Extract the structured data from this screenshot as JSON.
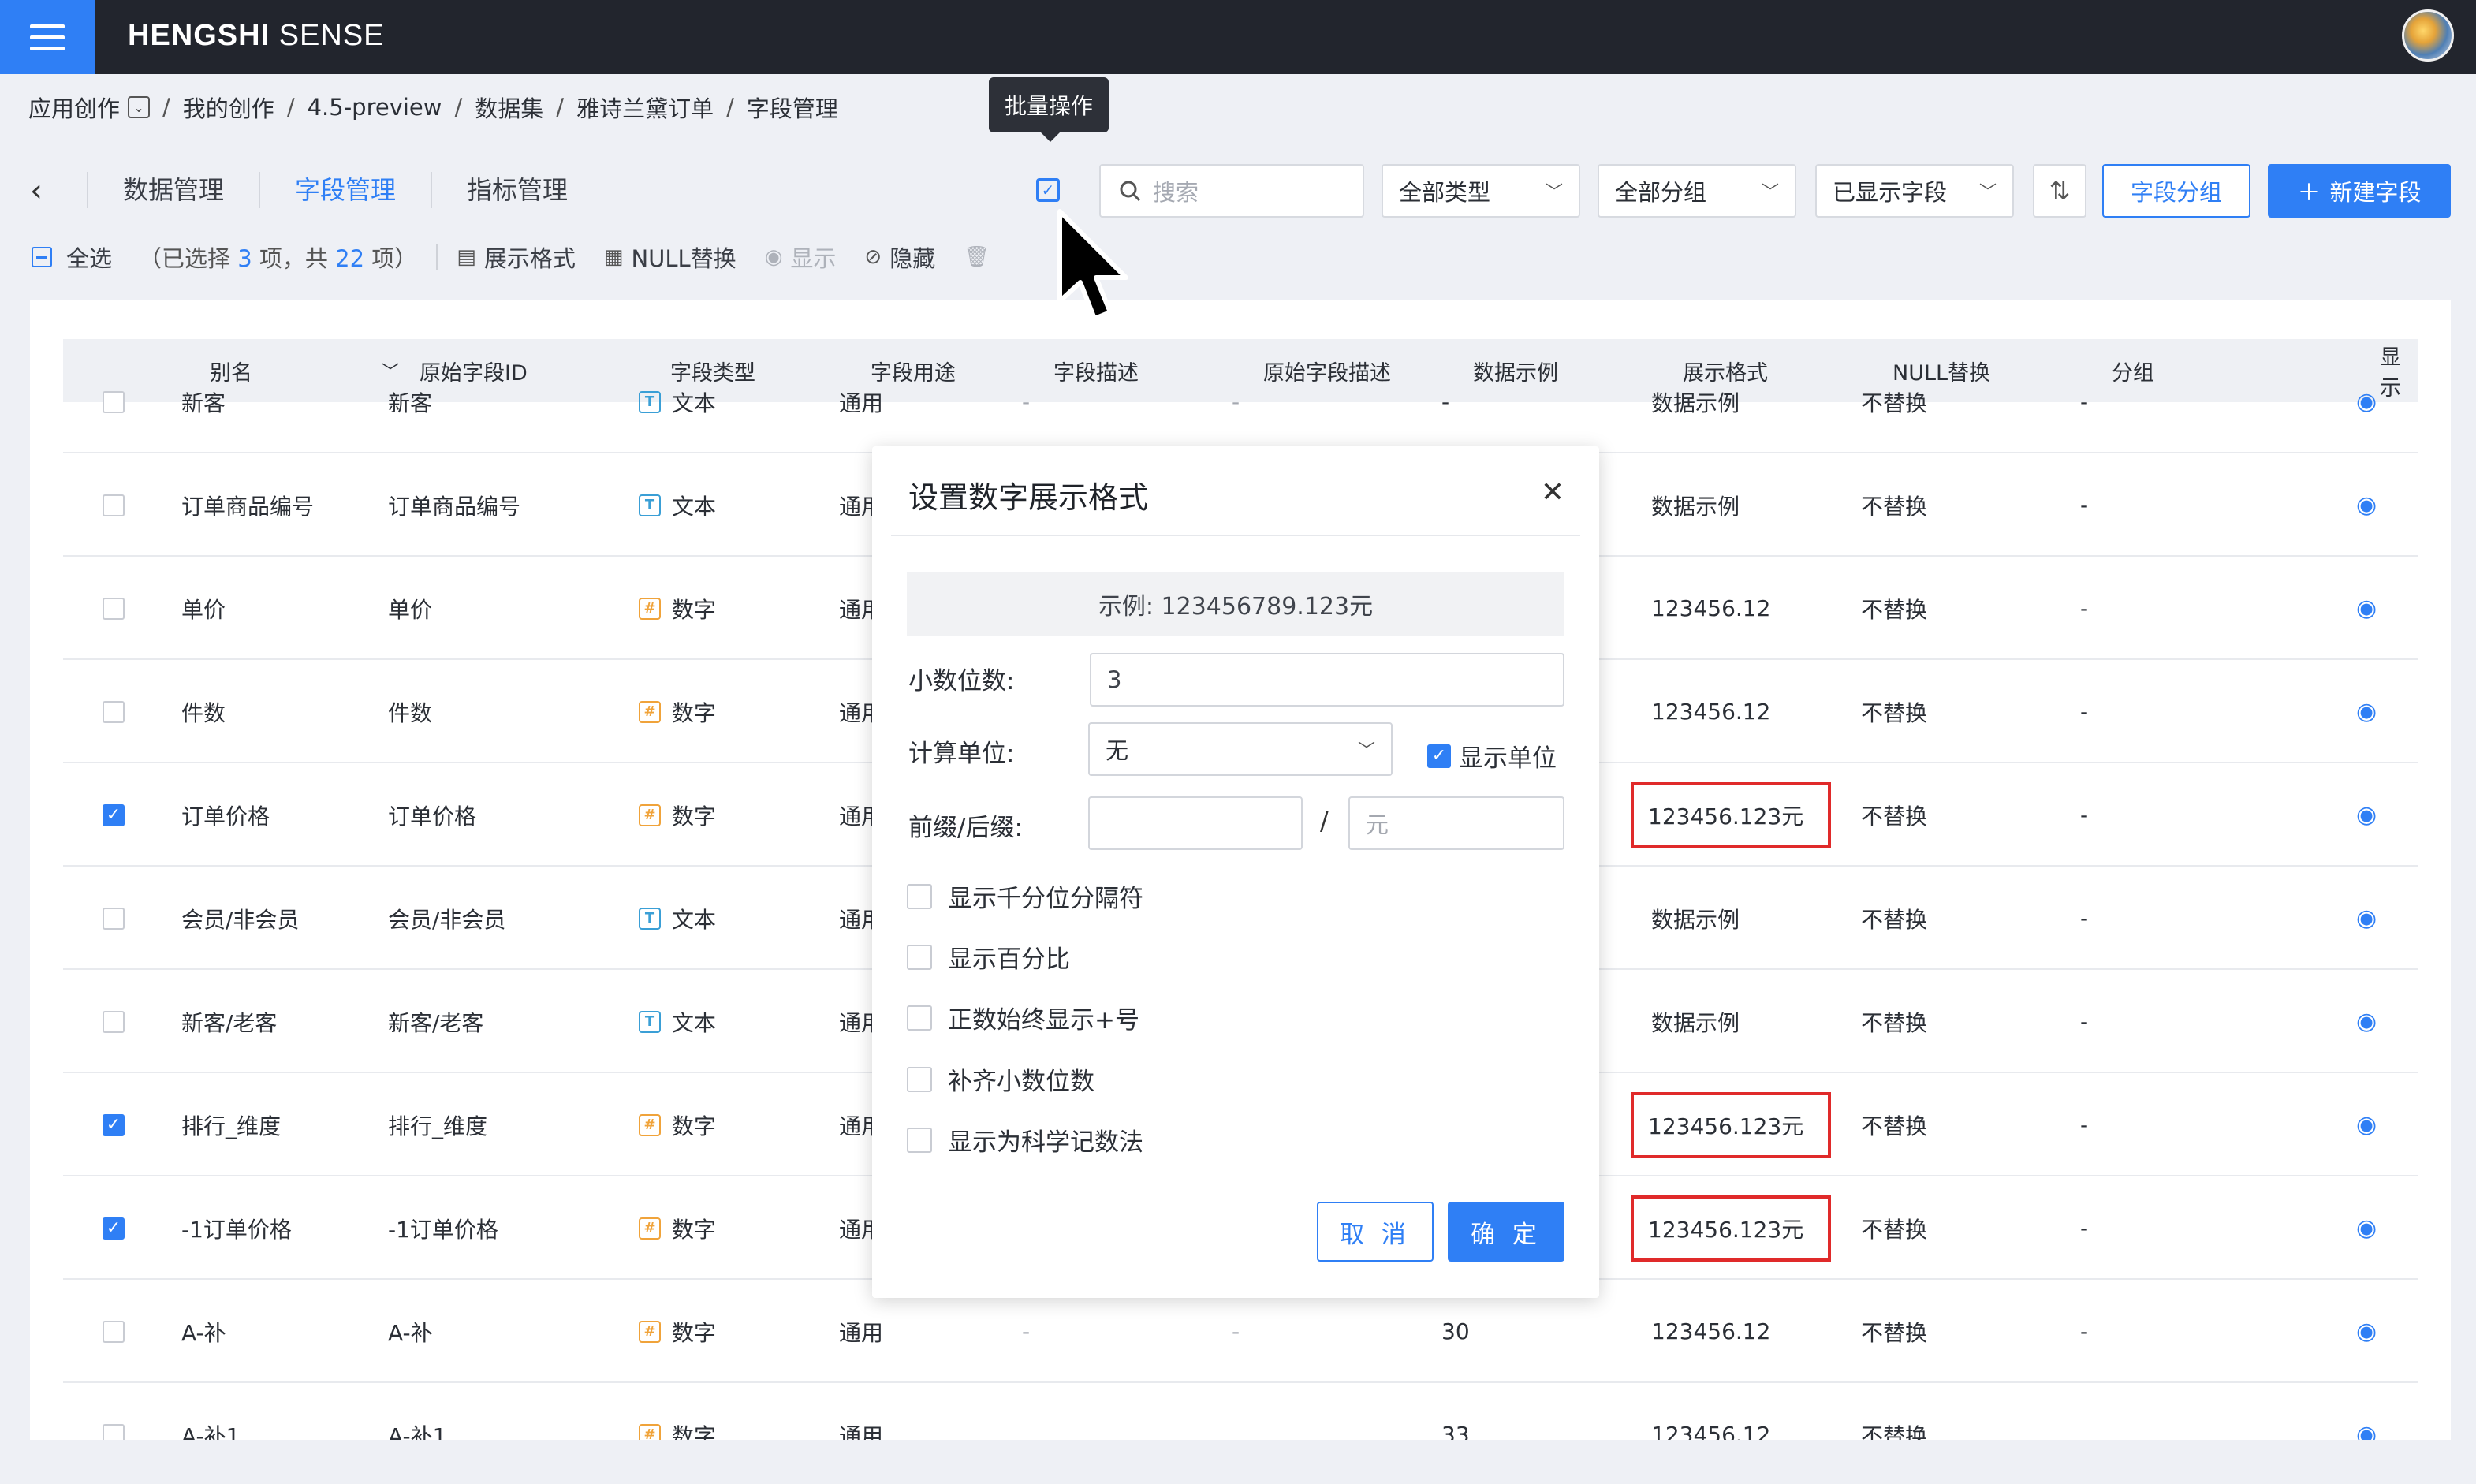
{
  "app": {
    "brand_bold": "HENGSHI",
    "brand_light": "SENSE"
  },
  "breadcrumb": {
    "root": "应用创作",
    "items": [
      "我的创作",
      "4.5-preview",
      "数据集",
      "雅诗兰黛订单",
      "字段管理"
    ]
  },
  "tooltip": "批量操作",
  "tabs": [
    "数据管理",
    "字段管理",
    "指标管理"
  ],
  "active_tab": "字段管理",
  "toolbar": {
    "search_placeholder": "搜索",
    "type_filter": "全部类型",
    "group_filter": "全部分组",
    "display_filter": "已显示字段",
    "group_button": "字段分组",
    "new_button": "新建字段"
  },
  "batch": {
    "select_all": "全选",
    "sel_prefix": "（已选择",
    "sel_mid": "项，共",
    "sel_suffix": "项）",
    "selected": "3",
    "total": "22",
    "format": "展示格式",
    "null_replace": "NULL替换",
    "show": "显示",
    "hide": "隐藏"
  },
  "table": {
    "headers": [
      "别名",
      "原始字段ID",
      "字段类型",
      "字段用途",
      "字段描述",
      "原始字段描述",
      "数据示例",
      "展示格式",
      "NULL替换",
      "分组",
      "显示"
    ],
    "partial_top": {
      "alias": "新客",
      "id": "新客",
      "type": "文本",
      "usage": "通用",
      "desc": "-",
      "orig_desc": "-",
      "sample": "-",
      "format": "数据示例",
      "null": "不替换",
      "group": "-"
    },
    "rows": [
      {
        "alias": "订单商品编号",
        "id": "订单商品编号",
        "type": "文本",
        "usage": "通用",
        "format": "数据示例",
        "null": "不替换",
        "group": "-",
        "checked": false,
        "highlight": false
      },
      {
        "alias": "单价",
        "id": "单价",
        "type": "数字",
        "usage": "通用",
        "format": "123456.12",
        "null": "不替换",
        "group": "-",
        "checked": false,
        "highlight": false
      },
      {
        "alias": "件数",
        "id": "件数",
        "type": "数字",
        "usage": "通用",
        "format": "123456.12",
        "null": "不替换",
        "group": "-",
        "checked": false,
        "highlight": false
      },
      {
        "alias": "订单价格",
        "id": "订单价格",
        "type": "数字",
        "usage": "通用",
        "format": "123456.123元",
        "null": "不替换",
        "group": "-",
        "checked": true,
        "highlight": true
      },
      {
        "alias": "会员/非会员",
        "id": "会员/非会员",
        "type": "文本",
        "usage": "通用",
        "format": "数据示例",
        "null": "不替换",
        "group": "-",
        "checked": false,
        "highlight": false
      },
      {
        "alias": "新客/老客",
        "id": "新客/老客",
        "type": "文本",
        "usage": "通用",
        "format": "数据示例",
        "null": "不替换",
        "group": "-",
        "checked": false,
        "highlight": false
      },
      {
        "alias": "排行_维度",
        "id": "排行_维度",
        "type": "数字",
        "usage": "通用",
        "format": "123456.123元",
        "null": "不替换",
        "group": "-",
        "checked": true,
        "highlight": true
      },
      {
        "alias": "-1订单价格",
        "id": "-1订单价格",
        "type": "数字",
        "usage": "通用",
        "format": "123456.123元",
        "null": "不替换",
        "group": "-",
        "checked": true,
        "highlight": true
      },
      {
        "alias": "A-补",
        "id": "A-补",
        "type": "数字",
        "usage": "通用",
        "desc": "-",
        "orig_desc": "-",
        "sample": "30",
        "format": "123456.12",
        "null": "不替换",
        "group": "-",
        "checked": false,
        "highlight": false
      }
    ],
    "partial_bottom": {
      "alias": "A-补1",
      "id": "A-补1",
      "type": "数字",
      "usage": "通用",
      "sample": "33",
      "format": "123456.12",
      "null": "不替换"
    }
  },
  "dialog": {
    "title": "设置数字展示格式",
    "example": "示例: 123456789.123元",
    "decimals_label": "小数位数:",
    "decimals_value": "3",
    "unit_label": "计算单位:",
    "unit_value": "无",
    "show_unit": "显示单位",
    "prefix_label": "前缀/后缀:",
    "prefix_value": "",
    "suffix_value": "元",
    "options": [
      "显示千分位分隔符",
      "显示百分比",
      "正数始终显示+号",
      "补齐小数位数",
      "显示为科学记数法"
    ],
    "cancel": "取 消",
    "ok": "确 定"
  },
  "colors": {
    "accent": "#2f7ff5",
    "topbar": "#22252d",
    "highlight": "#e02a2a",
    "text_type": "#3a9fd6",
    "number_type": "#f0a33a"
  },
  "icons": [
    "menu-icon",
    "back-icon",
    "batch-operation-icon",
    "search-icon",
    "sort-icon",
    "plus-icon",
    "format-icon",
    "null-icon",
    "eye-icon",
    "hide-icon",
    "trash-icon",
    "close-icon",
    "mouse-cursor-icon"
  ]
}
